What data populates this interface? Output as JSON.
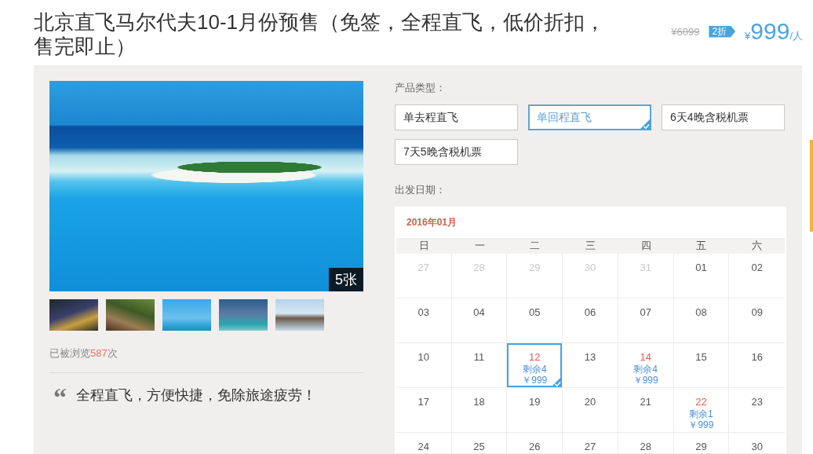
{
  "title": "北京直飞马尔代夫10-1月份预售（免签，全程直飞，低价折扣，售完即止）",
  "pricing": {
    "original_price": "¥6099",
    "discount": "2折",
    "currency": "¥",
    "amount": "999",
    "unit": "/人"
  },
  "gallery": {
    "photo_count": "5张"
  },
  "views": {
    "prefix": "已被浏览",
    "count": "587",
    "suffix": "次"
  },
  "quote": {
    "mark": "“",
    "text": "全程直飞，方便快捷，免除旅途疲劳！"
  },
  "product_types": {
    "label": "产品类型：",
    "options": [
      {
        "label": "单去程直飞",
        "selected": false
      },
      {
        "label": "单回程直飞",
        "selected": true
      },
      {
        "label": "6天4晚含税机票",
        "selected": false
      },
      {
        "label": "7天5晚含税机票",
        "selected": false
      }
    ]
  },
  "departure": {
    "label": "出发日期：",
    "month": "2016年01月",
    "weekdays": [
      "日",
      "一",
      "二",
      "三",
      "四",
      "五",
      "六"
    ],
    "weeks": [
      {
        "days": [
          {
            "day": "27",
            "kind": "outside",
            "selected": false
          },
          {
            "day": "28",
            "kind": "outside",
            "selected": false
          },
          {
            "day": "29",
            "kind": "outside",
            "selected": false
          },
          {
            "day": "30",
            "kind": "outside",
            "selected": false
          },
          {
            "day": "31",
            "kind": "outside",
            "selected": false
          },
          {
            "day": "01",
            "kind": "normal",
            "selected": false
          },
          {
            "day": "02",
            "kind": "normal",
            "selected": false
          }
        ]
      },
      {
        "days": [
          {
            "day": "03",
            "kind": "normal",
            "selected": false
          },
          {
            "day": "04",
            "kind": "normal",
            "selected": false
          },
          {
            "day": "05",
            "kind": "normal",
            "selected": false
          },
          {
            "day": "06",
            "kind": "normal",
            "selected": false
          },
          {
            "day": "07",
            "kind": "normal",
            "selected": false
          },
          {
            "day": "08",
            "kind": "normal",
            "selected": false
          },
          {
            "day": "09",
            "kind": "normal",
            "selected": false
          }
        ]
      },
      {
        "days": [
          {
            "day": "10",
            "kind": "normal",
            "selected": false
          },
          {
            "day": "11",
            "kind": "normal",
            "selected": false
          },
          {
            "day": "12",
            "kind": "available",
            "selected": true,
            "remaining": "剩余4",
            "price": "￥999"
          },
          {
            "day": "13",
            "kind": "normal",
            "selected": false
          },
          {
            "day": "14",
            "kind": "available",
            "selected": false,
            "remaining": "剩余4",
            "price": "￥999"
          },
          {
            "day": "15",
            "kind": "normal",
            "selected": false
          },
          {
            "day": "16",
            "kind": "normal",
            "selected": false
          }
        ]
      },
      {
        "days": [
          {
            "day": "17",
            "kind": "normal",
            "selected": false
          },
          {
            "day": "18",
            "kind": "normal",
            "selected": false
          },
          {
            "day": "19",
            "kind": "normal",
            "selected": false
          },
          {
            "day": "20",
            "kind": "normal",
            "selected": false
          },
          {
            "day": "21",
            "kind": "normal",
            "selected": false
          },
          {
            "day": "22",
            "kind": "available",
            "selected": false,
            "remaining": "剩余1",
            "price": "￥999"
          },
          {
            "day": "23",
            "kind": "normal",
            "selected": false
          }
        ]
      },
      {
        "days": [
          {
            "day": "24",
            "kind": "normal",
            "selected": false
          },
          {
            "day": "25",
            "kind": "normal",
            "selected": false
          },
          {
            "day": "26",
            "kind": "normal",
            "selected": false
          },
          {
            "day": "27",
            "kind": "normal",
            "selected": false
          },
          {
            "day": "28",
            "kind": "normal",
            "selected": false
          },
          {
            "day": "29",
            "kind": "normal",
            "selected": false
          },
          {
            "day": "30",
            "kind": "normal",
            "selected": false
          }
        ]
      }
    ]
  }
}
